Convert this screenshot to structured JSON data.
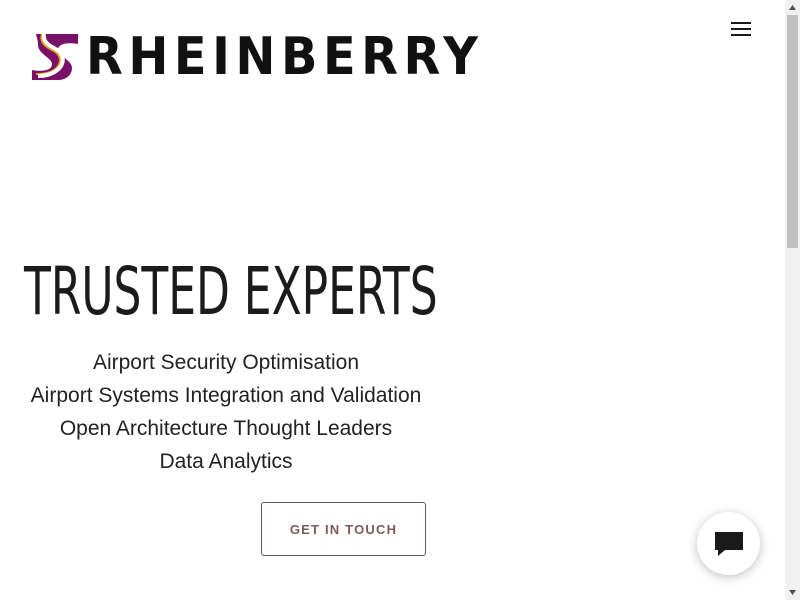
{
  "header": {
    "logo_text": "RHEINBERRY",
    "menu_icon": "hamburger-menu-icon"
  },
  "hero": {
    "title": "TRUSTED EXPERTS",
    "services": [
      "Airport Security Optimisation",
      "Airport Systems Integration and Validation",
      "Open Architecture Thought Leaders",
      "Data Analytics"
    ],
    "cta_label": "GET IN TOUCH"
  },
  "chat": {
    "icon": "chat-bubble-icon"
  },
  "colors": {
    "logo_purple": "#7a1068",
    "logo_gold": "#e0a020",
    "title_text": "#1b1b1b",
    "cta_border": "#6e4f4f",
    "cta_text": "#7a5c5c"
  }
}
